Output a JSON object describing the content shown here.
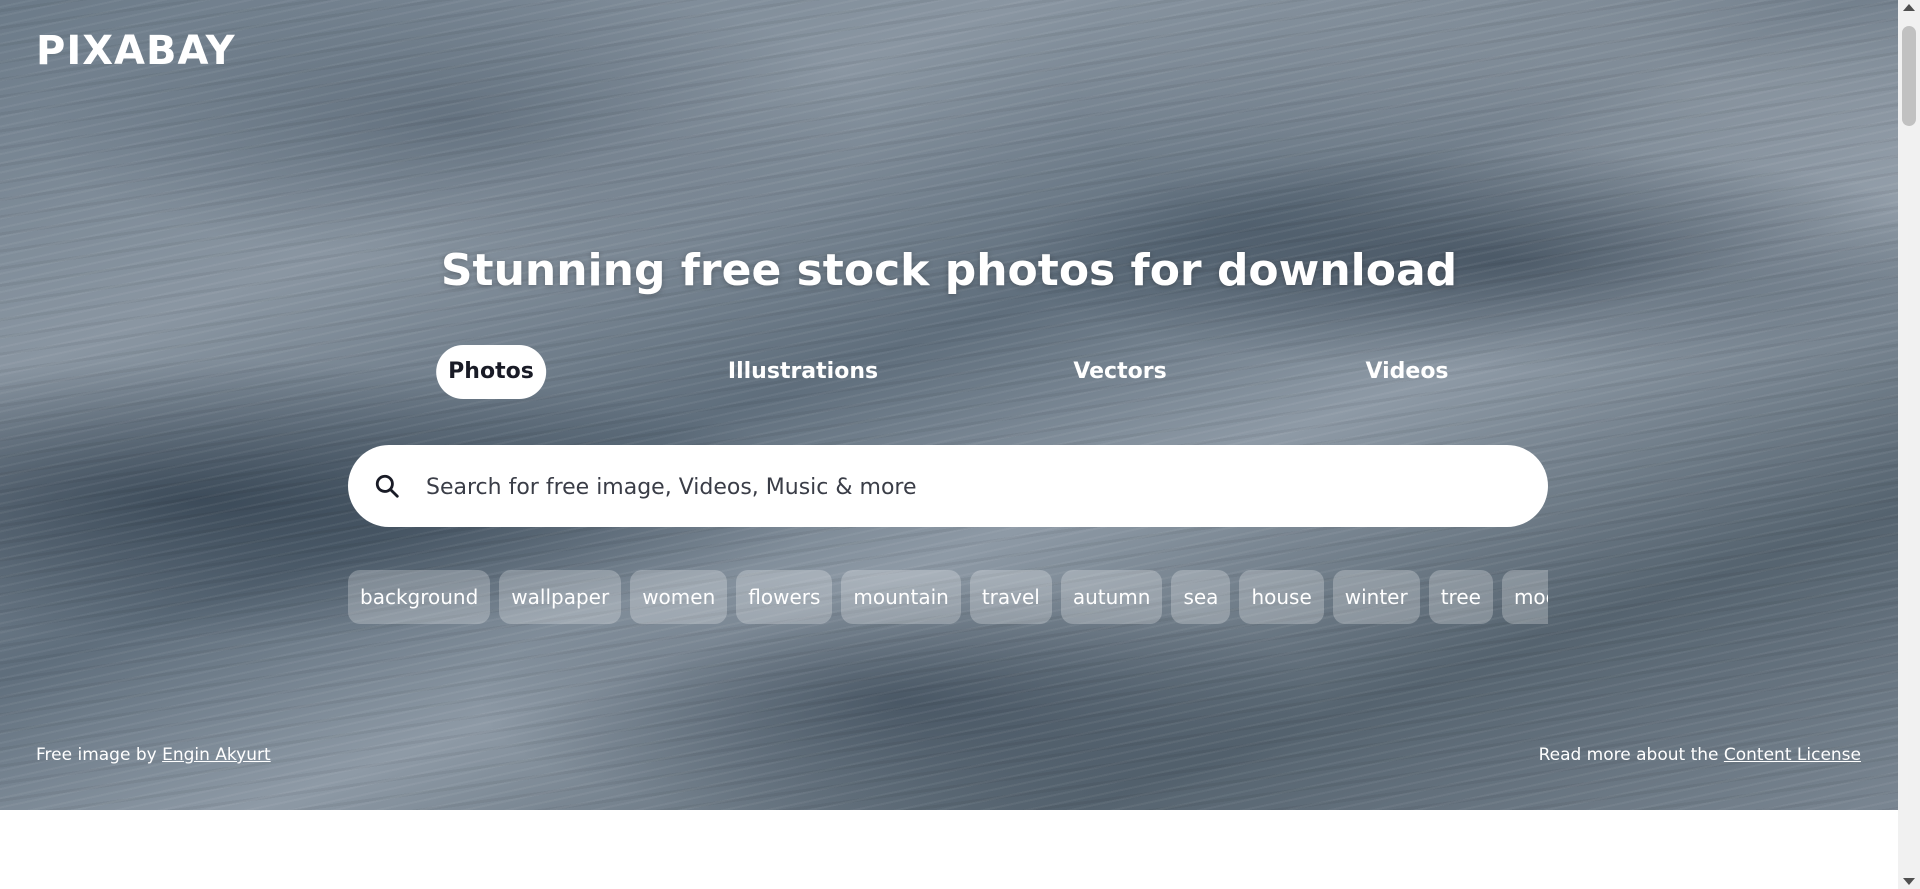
{
  "brand": {
    "logo_text": "PIXABAY"
  },
  "hero": {
    "headline": "Stunning free stock photos for download",
    "tabs": [
      {
        "label": "Photos",
        "active": true
      },
      {
        "label": "Illustrations",
        "active": false
      },
      {
        "label": "Vectors",
        "active": false
      },
      {
        "label": "Videos",
        "active": false
      }
    ],
    "search": {
      "placeholder": "Search for free image, Videos, Music & more",
      "value": "",
      "icon": "search-icon"
    },
    "tags": [
      "background",
      "wallpaper",
      "women",
      "flowers",
      "mountain",
      "travel",
      "autumn",
      "sea",
      "house",
      "winter",
      "tree",
      "moon"
    ],
    "credit": {
      "prefix": "Free image by ",
      "author": "Engin Akyurt"
    },
    "license": {
      "prefix": "Read more about the ",
      "link": "Content License"
    }
  },
  "colors": {
    "active_tab_bg": "#ffffff",
    "text_on_hero": "#ffffff",
    "dark_text": "#191b26"
  }
}
